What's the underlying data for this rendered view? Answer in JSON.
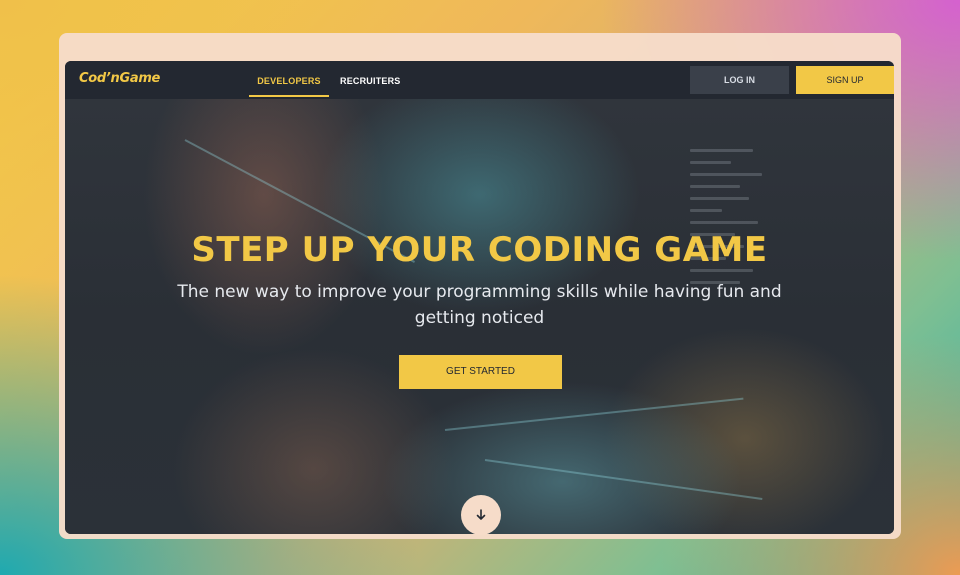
{
  "brand": {
    "logo_text": "Cod’nGame"
  },
  "nav": {
    "tabs": [
      {
        "label": "DEVELOPERS",
        "active": true
      },
      {
        "label": "RECRUITERS",
        "active": false
      }
    ],
    "login_label": "LOG IN",
    "signup_label": "SIGN UP"
  },
  "hero": {
    "headline": "STEP UP YOUR CODING GAME",
    "subtitle": "The new way to improve your programming skills while having fun and getting noticed",
    "cta_label": "GET STARTED"
  },
  "scroll": {
    "icon": "arrow-down-icon"
  },
  "colors": {
    "accent": "#f2c846",
    "navbar": "#232831",
    "login_bg": "#3a404a",
    "frame": "#f6dcc9"
  }
}
